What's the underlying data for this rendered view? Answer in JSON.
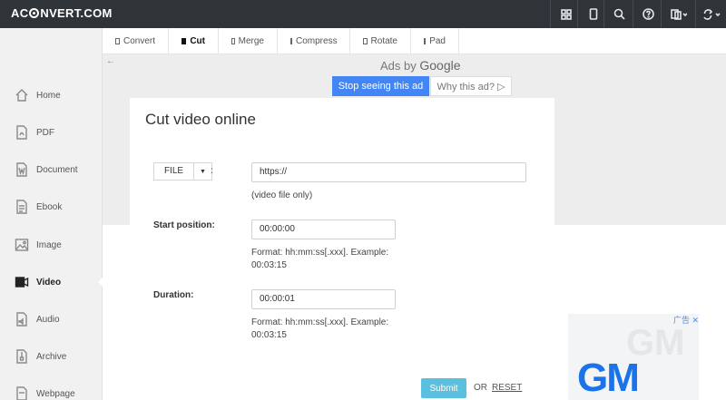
{
  "header": {
    "logo_prefix": "AC",
    "logo_suffix": "NVERT.COM"
  },
  "icons": {
    "grid": "grid-icon",
    "mobile": "mobile-icon",
    "search": "search-icon",
    "help": "help-icon",
    "language": "language-icon",
    "sync": "sync-icon"
  },
  "sidebar": {
    "items": [
      {
        "label": "Home",
        "icon": "home-icon"
      },
      {
        "label": "PDF",
        "icon": "pdf-icon"
      },
      {
        "label": "Document",
        "icon": "document-icon"
      },
      {
        "label": "Ebook",
        "icon": "ebook-icon"
      },
      {
        "label": "Image",
        "icon": "image-icon"
      },
      {
        "label": "Video",
        "icon": "video-icon"
      },
      {
        "label": "Audio",
        "icon": "audio-icon"
      },
      {
        "label": "Archive",
        "icon": "archive-icon"
      },
      {
        "label": "Webpage",
        "icon": "webpage-icon"
      }
    ],
    "active": "Video"
  },
  "tabs": [
    {
      "label": "Convert"
    },
    {
      "label": "Cut"
    },
    {
      "label": "Merge"
    },
    {
      "label": "Compress"
    },
    {
      "label": "Rotate"
    },
    {
      "label": "Pad"
    }
  ],
  "ad": {
    "ads_by": "Ads by",
    "google": "Google",
    "stop_label": "Stop seeing this ad",
    "why_label": "Why this ad? ▷"
  },
  "main": {
    "title": "Cut video online",
    "file_button": "FILE",
    "url_value": "https://",
    "url_hint": "(video file only)",
    "start_label": "Start position:",
    "start_value": "00:00:00",
    "format_hint_line1": "Format: hh:mm:ss[.xxx]. Example:",
    "format_hint_line2": "00:03:15",
    "duration_label": "Duration:",
    "duration_value": "00:00:01",
    "submit_label": "Submit",
    "or_label": "OR",
    "reset_label": "RESET"
  },
  "ad2": {
    "close_label": "广告 ✕",
    "logo": "GM"
  },
  "colors": {
    "topbar": "#2f3439",
    "submit": "#5bc0de",
    "ad_button": "#4285f4"
  }
}
